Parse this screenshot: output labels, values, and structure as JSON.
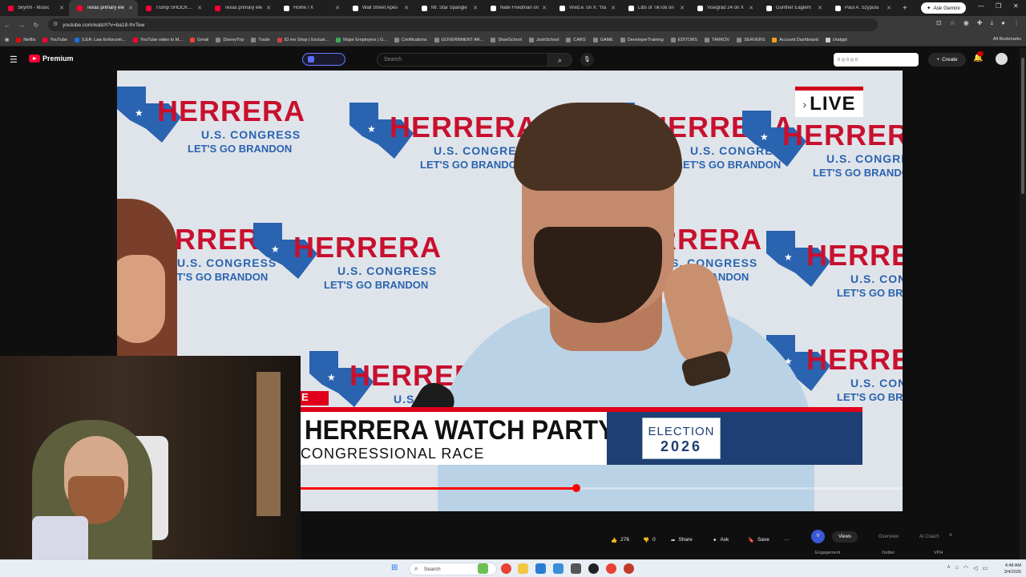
{
  "browser": {
    "tabs": [
      {
        "title": "Skyrim - Music",
        "color": "#ff0033",
        "active": false
      },
      {
        "title": "Texas primary ele",
        "color": "#ff0033",
        "active": true
      },
      {
        "title": "Trump SHOCKS S",
        "color": "#ff0033",
        "active": false
      },
      {
        "title": "Texas primary ele",
        "color": "#ff0033",
        "active": false
      },
      {
        "title": "Home / X",
        "color": "#ffffff",
        "active": false
      },
      {
        "title": "Wall Street Apes",
        "color": "#ffffff",
        "active": false
      },
      {
        "title": "Mr. Star Spangle",
        "color": "#ffffff",
        "active": false
      },
      {
        "title": "Nate Friedman on",
        "color": "#ffffff",
        "active": false
      },
      {
        "title": "Vivid.e. on X: \"tra",
        "color": "#ffffff",
        "active": false
      },
      {
        "title": "Libs of TikTok on",
        "color": "#ffffff",
        "active": false
      },
      {
        "title": "Visegrád 24 on X",
        "color": "#ffffff",
        "active": false
      },
      {
        "title": "Gunther Eaglem",
        "color": "#ffffff",
        "active": false
      },
      {
        "title": "Paul A. Szypula",
        "color": "#ffffff",
        "active": false
      }
    ],
    "new_tab": "+",
    "ask_gemini": "Ask Gemini",
    "url": "youtube.com/watch?v=ba18-IhrTew",
    "bookmarks": [
      {
        "label": "Netflix",
        "color": "#e50914"
      },
      {
        "label": "YouTube",
        "color": "#ff0033"
      },
      {
        "label": "ILEA: Law Enforcem...",
        "color": "#1d6fd6"
      },
      {
        "label": "YouTube video to M...",
        "color": "#ff0033"
      },
      {
        "label": "Gmail",
        "color": "#ea4335"
      },
      {
        "label": "DisneyTrip",
        "color": "#888888"
      },
      {
        "label": "Trade",
        "color": "#888888"
      },
      {
        "label": "ID.me Shop | Exclusi...",
        "color": "#d04040"
      },
      {
        "label": "Major Employers | G...",
        "color": "#3aaa55"
      },
      {
        "label": "Certifications",
        "color": "#888888"
      },
      {
        "label": "GOVERNMENT AR...",
        "color": "#888888"
      },
      {
        "label": "ShaeSchool",
        "color": "#888888"
      },
      {
        "label": "JoshSchool",
        "color": "#888888"
      },
      {
        "label": "CARS",
        "color": "#888888"
      },
      {
        "label": "GAME",
        "color": "#888888"
      },
      {
        "label": "DeveloperTraining",
        "color": "#888888"
      },
      {
        "label": "EDITORS",
        "color": "#888888"
      },
      {
        "label": "TARKOV",
        "color": "#888888"
      },
      {
        "label": "SERVERS",
        "color": "#888888"
      },
      {
        "label": "Account Dashboard",
        "color": "#f0a020"
      },
      {
        "label": "chatgpt",
        "color": "#cccccc"
      }
    ],
    "all_bookmarks": "All Bookmarks"
  },
  "youtube": {
    "logo_text": "Premium",
    "search_placeholder": "Search",
    "stats_pill": "0 ◎ 0 ◎ 0",
    "create_label": "Create",
    "accent": "#ff0033"
  },
  "video": {
    "backdrop_name": "HERRERA",
    "backdrop_sub": "U.S. CONGRESS",
    "backdrop_slogan": "LET'S GO BRANDON",
    "backdrop_slogan_partial": "O BRANDON",
    "backdrop_name_partial": "RERA",
    "live_label": "LIVE",
    "lower_third_tag": "E",
    "lower_third_title": "HERRERA WATCH PARTY",
    "lower_third_sub": "CONGRESSIONAL RACE",
    "election_line1": "ELECTION",
    "election_line2": "2026",
    "progress_fraction": 0.458,
    "accent_blue": "#1d3f73",
    "accent_red": "#c8102e"
  },
  "actions": {
    "likes": "276",
    "dislikes": "0",
    "share": "Share",
    "ask": "Ask",
    "save": "Save",
    "more": "···"
  },
  "side_panel": {
    "tabs": [
      "Views",
      "Overview",
      "AI Coach"
    ],
    "subs": [
      "Engagement",
      "Outlier",
      "VPH"
    ]
  },
  "taskbar": {
    "search_placeholder": "Search",
    "time": "4:48 AM",
    "date": "3/4/2026"
  }
}
